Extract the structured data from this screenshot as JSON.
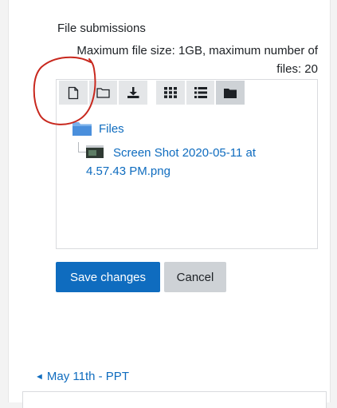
{
  "submission": {
    "label": "File submissions",
    "limits": "Maximum file size: 1GB, maximum number of files: 20"
  },
  "toolbar": {
    "buttons": [
      {
        "icon": "file-icon",
        "title": "Add..."
      },
      {
        "icon": "folder-icon",
        "title": "Create folder"
      },
      {
        "icon": "download-icon",
        "title": "Download"
      },
      {
        "icon": "grid-icon",
        "title": "Display folder with file icons"
      },
      {
        "icon": "list-icon",
        "title": "Display folder with file details"
      },
      {
        "icon": "folder-tree-icon",
        "title": "Display folder as file tree",
        "active": true
      }
    ]
  },
  "filemanager": {
    "root_folder": "Files",
    "file_name": "Screen Shot 2020-05-11 at 4.57.43 PM.png"
  },
  "actions": {
    "save_label": "Save changes",
    "cancel_label": "Cancel"
  },
  "navigation": {
    "prev_arrow": "◄",
    "prev_label": "May 11th - PPT"
  },
  "colors": {
    "accent": "#0f6cbf",
    "toolbar_bg": "#e4e6e8",
    "annotation": "#c8281e"
  }
}
